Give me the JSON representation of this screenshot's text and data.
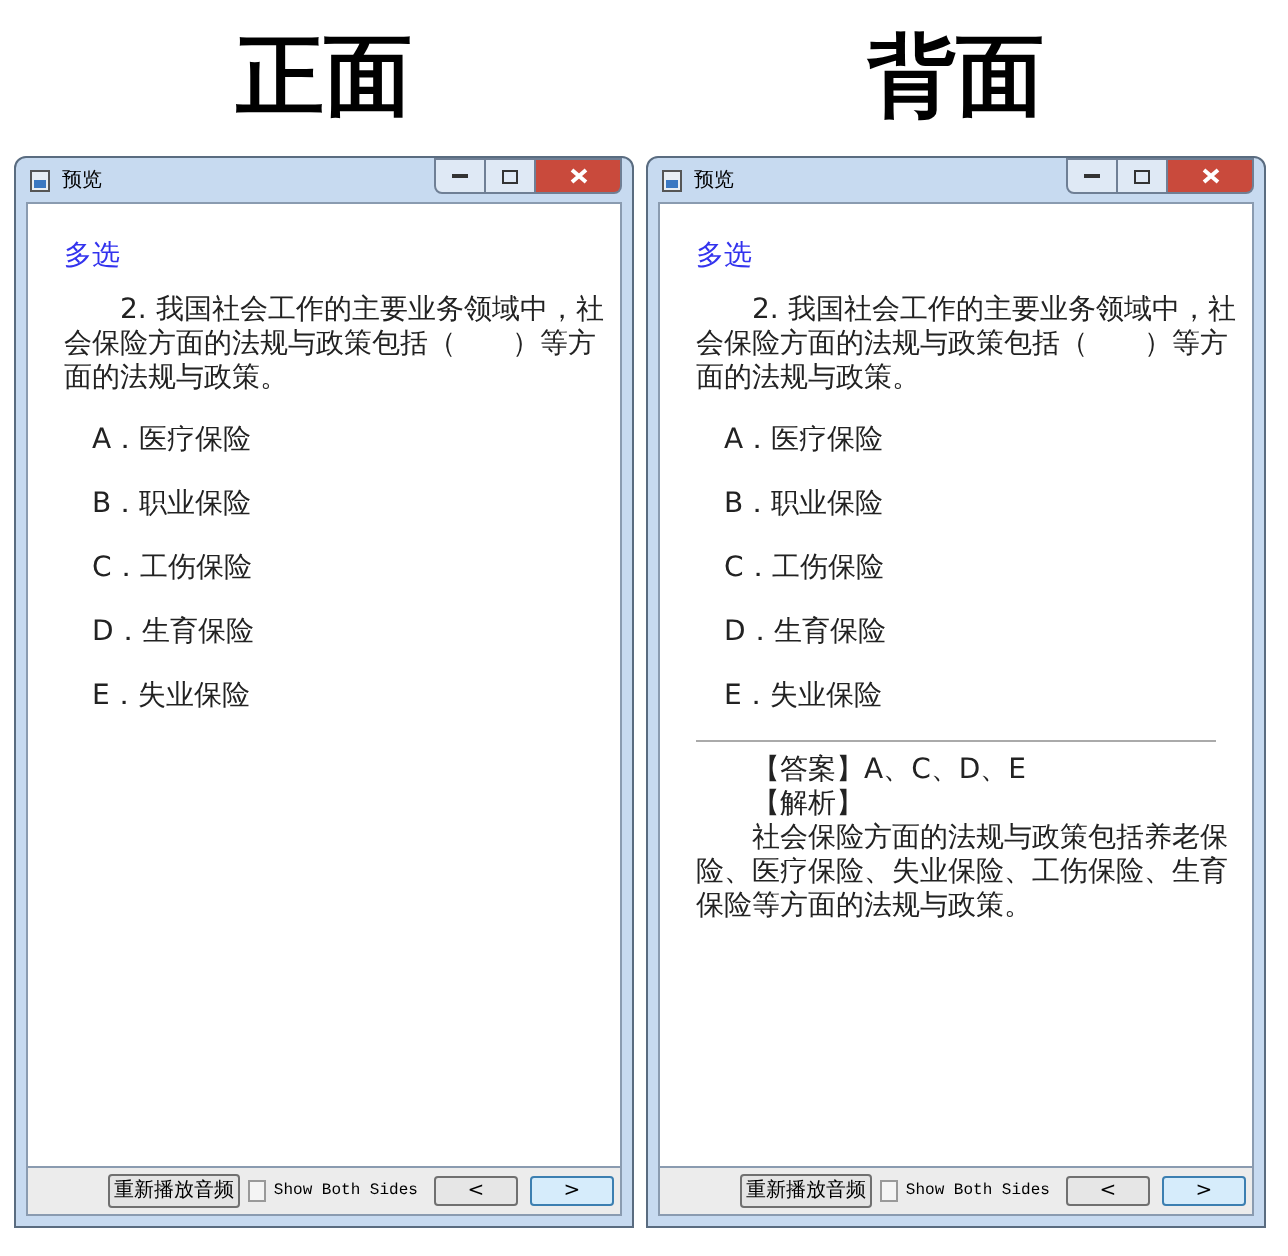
{
  "panels": [
    {
      "heading": "正面",
      "window": {
        "title": "预览"
      },
      "question_type": "多选",
      "question": "2. 我国社会工作的主要业务领域中，社会保险方面的法规与政策包括（　　）等方面的法规与政策。",
      "options": [
        "A．医疗保险",
        "B．职业保险",
        "C．工伤保险",
        "D．生育保险",
        "E．失业保险"
      ],
      "footer": {
        "replay_button": "重新播放音频",
        "show_both_sides": {
          "label": "Show Both Sides",
          "checked": false
        },
        "prev_button": "<",
        "next_button": ">"
      }
    },
    {
      "heading": "背面",
      "window": {
        "title": "预览"
      },
      "question_type": "多选",
      "question": "2. 我国社会工作的主要业务领域中，社会保险方面的法规与政策包括（　　）等方面的法规与政策。",
      "options": [
        "A．医疗保险",
        "B．职业保险",
        "C．工伤保险",
        "D．生育保险",
        "E．失业保险"
      ],
      "answer": {
        "answer_line": "【答案】A、C、D、E",
        "analysis_label": "【解析】",
        "analysis": "社会保险方面的法规与政策包括养老保险、医疗保险、失业保险、工伤保险、生育保险等方面的法规与政策。"
      },
      "footer": {
        "replay_button": "重新播放音频",
        "show_both_sides": {
          "label": "Show Both Sides",
          "checked": false
        },
        "prev_button": "<",
        "next_button": ">"
      }
    }
  ]
}
